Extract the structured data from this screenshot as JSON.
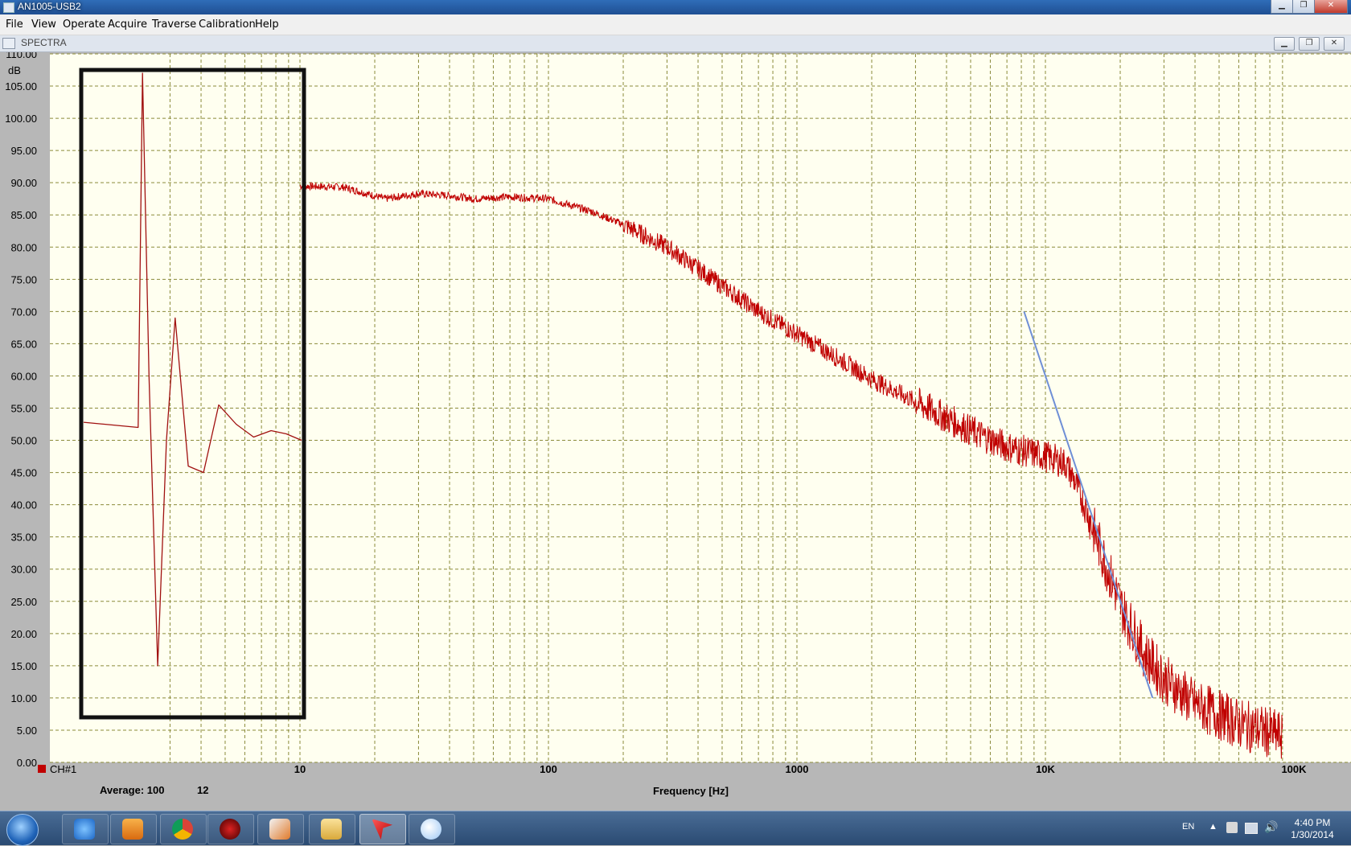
{
  "window": {
    "title": "AN1005-USB2",
    "min": "▁",
    "max": "❐",
    "close": "✕"
  },
  "menu": [
    "File",
    "View",
    "Operate",
    "Acquire",
    "Traverse",
    "Calibration",
    "Help"
  ],
  "child_window": {
    "title": "SPECTRA"
  },
  "status": {
    "average_label": "Average: 100",
    "average_count": "12"
  },
  "taskbar": {
    "apps": [
      "ie-icon",
      "media-icon",
      "chrome-icon",
      "bug-icon",
      "tools-icon",
      "folder-icon",
      "red-arrow-icon",
      "paint-icon"
    ],
    "lang": "EN",
    "time": "4:40 PM",
    "date": "1/30/2014"
  },
  "colors": {
    "plot_bg": "#fffff0",
    "grid": "#8b8b3a",
    "trace": "#c00000",
    "fit_line": "#6f8fd6",
    "frame_bg": "#b7b7b7"
  },
  "chart_data": {
    "type": "line",
    "x_scale": "log",
    "xlabel": "Frequency [Hz]",
    "ylabel": "dB",
    "xlim": [
      3,
      100000
    ],
    "ylim": [
      0,
      110
    ],
    "x_tick_labels": [
      "10",
      "100",
      "1000",
      "10K",
      "100K"
    ],
    "y_tick_labels": [
      "110.00",
      "105.00",
      "100.00",
      "95.00",
      "90.00",
      "85.00",
      "80.00",
      "75.00",
      "70.00",
      "65.00",
      "60.00",
      "55.00",
      "50.00",
      "45.00",
      "40.00",
      "35.00",
      "30.00",
      "25.00",
      "20.00",
      "15.00",
      "10.00",
      "5.00",
      "0.00"
    ],
    "grid": true,
    "legend": {
      "position": "bottom-left",
      "entries": [
        "CH#1"
      ]
    },
    "series": [
      {
        "name": "CH#1",
        "x": [
          10,
          15,
          22,
          30,
          40,
          50,
          70,
          100,
          150,
          200,
          300,
          500,
          700,
          1000,
          1500,
          2000,
          3000,
          5000,
          7000,
          10000,
          12000,
          13000,
          14000,
          16000,
          20000,
          25000,
          30000,
          40000,
          60000,
          90000
        ],
        "y": [
          89.5,
          89.3,
          87.5,
          88.3,
          88.0,
          87.5,
          87.8,
          87.5,
          85.5,
          83.5,
          80.0,
          74.0,
          70.0,
          66.5,
          62.5,
          59.5,
          56.0,
          51.5,
          49.0,
          47.5,
          46.5,
          44.0,
          41.0,
          35.0,
          24.5,
          17.0,
          13.0,
          9.0,
          6.0,
          4.0
        ]
      },
      {
        "name": "fit line",
        "x": [
          8200,
          27000
        ],
        "y": [
          70.0,
          10.0
        ]
      }
    ],
    "inset": {
      "description_only": false,
      "x": [
        0.0,
        0.25,
        0.25,
        0.27,
        0.3,
        0.34,
        0.38,
        0.42,
        0.48,
        0.55,
        0.62,
        0.7,
        0.78,
        0.86,
        0.93,
        1.0
      ],
      "y": [
        52.8,
        52.0,
        52.0,
        107.0,
        60.0,
        15.0,
        50.0,
        69.0,
        46.0,
        45.0,
        55.5,
        52.5,
        50.5,
        51.5,
        51.0,
        50.0
      ]
    }
  }
}
